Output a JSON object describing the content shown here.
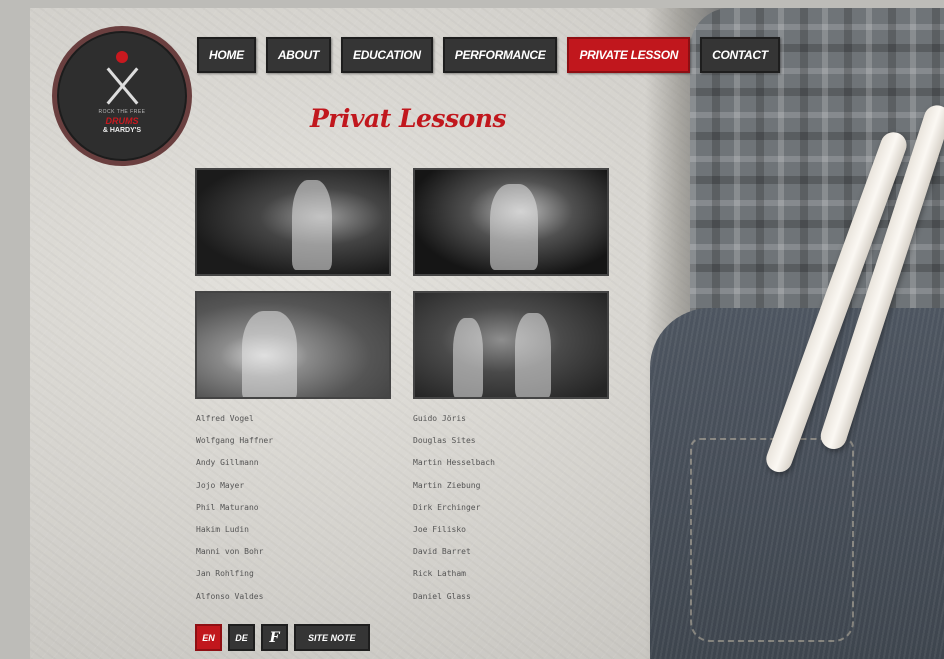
{
  "logo": {
    "line1": "ROCK THE FREE",
    "line2": "DRUMS",
    "line3": "& HARDY'S"
  },
  "nav": {
    "items": [
      {
        "label": "Home"
      },
      {
        "label": "About"
      },
      {
        "label": "Education"
      },
      {
        "label": "Performance"
      },
      {
        "label": "Private Lesson",
        "active": true
      },
      {
        "label": "Contact"
      }
    ]
  },
  "title": "Privat Lessons",
  "names": {
    "col1": [
      "Alfred Vogel",
      "Wolfgang Haffner",
      "Andy Gillmann",
      "Jojo Mayer",
      "Phil Maturano",
      "Hakim Ludin",
      "Manni von Bohr",
      "Jan Rohlfing",
      "Alfonso Valdes"
    ],
    "col2": [
      "Guido Jöris",
      "Douglas Sites",
      "Martin Hesselbach",
      "Martin Ziebung",
      "Dirk Erchinger",
      "Joe Filisko",
      "David Barret",
      "Rick Latham",
      "Daniel Glass"
    ]
  },
  "footer": {
    "en": "EN",
    "de": "DE",
    "facebook": "f",
    "sitenote": "Site Note"
  },
  "colors": {
    "accent": "#c1171d",
    "button": "#353535"
  }
}
